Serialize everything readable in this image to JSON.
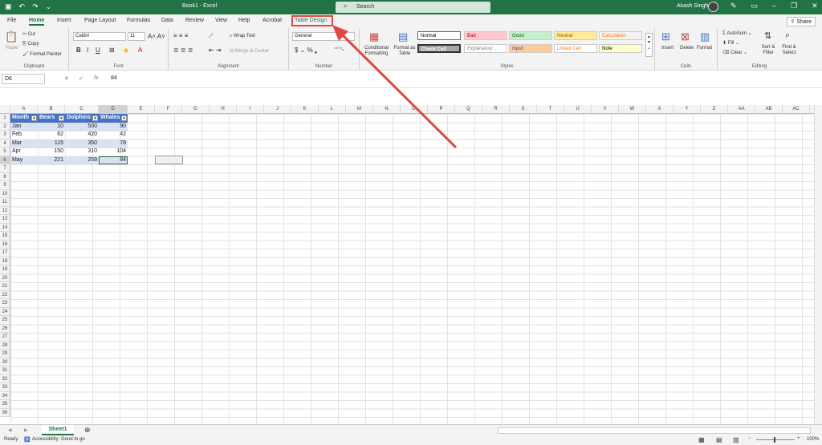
{
  "title_bar": {
    "title": "Book1 - Excel",
    "search_placeholder": "Search",
    "user_name": "Akash Singh"
  },
  "tabs": [
    "File",
    "Home",
    "Insert",
    "Page Layout",
    "Formulas",
    "Data",
    "Review",
    "View",
    "Help",
    "Acrobat",
    "Table Design"
  ],
  "share_label": "Share",
  "ribbon": {
    "clipboard": {
      "label": "Clipboard",
      "paste": "Paste",
      "cut": "Cut",
      "copy": "Copy",
      "format_painter": "Format Painter"
    },
    "font": {
      "label": "Font",
      "name": "Calibri",
      "size": "11"
    },
    "alignment": {
      "label": "Alignment",
      "wrap_text": "Wrap Text",
      "merge_center": "Merge & Center"
    },
    "number": {
      "label": "Number",
      "format": "General"
    },
    "styles": {
      "label": "Styles",
      "conditional_formatting": "Conditional Formatting",
      "format_as_table": "Format as Table",
      "cells": [
        {
          "text": "Normal",
          "bg": "#ffffff",
          "fg": "#000000"
        },
        {
          "text": "Bad",
          "bg": "#ffc7ce",
          "fg": "#9c0006"
        },
        {
          "text": "Good",
          "bg": "#c6efce",
          "fg": "#006100"
        },
        {
          "text": "Neutral",
          "bg": "#ffeb9c",
          "fg": "#9c5700"
        },
        {
          "text": "Calculation",
          "bg": "#f2f2f2",
          "fg": "#fa7d00"
        },
        {
          "text": "Check Cell",
          "bg": "#a5a5a5",
          "fg": "#ffffff"
        },
        {
          "text": "Explanatory ...",
          "bg": "#ffffff",
          "fg": "#7f7f7f"
        },
        {
          "text": "Input",
          "bg": "#ffcc99",
          "fg": "#3f3f76"
        },
        {
          "text": "Linked Cell",
          "bg": "#ffffff",
          "fg": "#fa7d00"
        },
        {
          "text": "Note",
          "bg": "#ffffcc",
          "fg": "#000000"
        }
      ]
    },
    "cells": {
      "label": "Cells",
      "insert": "Insert",
      "delete": "Delete",
      "format": "Format"
    },
    "editing": {
      "label": "Editing",
      "autosum": "AutoSum",
      "fill": "Fill",
      "clear": "Clear",
      "sort_filter": "Sort & Filter",
      "find_select": "Find & Select"
    }
  },
  "formula_bar": {
    "name_box": "D6",
    "value": "84"
  },
  "columns": [
    "A",
    "B",
    "C",
    "D",
    "E",
    "F",
    "G",
    "H",
    "I",
    "J",
    "K",
    "L",
    "M",
    "N",
    "O",
    "P",
    "Q",
    "R",
    "S",
    "T",
    "U",
    "V",
    "W",
    "X",
    "Y",
    "Z",
    "AA",
    "AB",
    "AC"
  ],
  "row_count": 36,
  "table": {
    "headers": [
      "Month",
      "Bears",
      "Dolphins",
      "Whales"
    ],
    "rows": [
      [
        "Jan",
        "10",
        "500",
        "90"
      ],
      [
        "Feb",
        "62",
        "420",
        "42"
      ],
      [
        "Mar",
        "115",
        "350",
        "78"
      ],
      [
        "Apr",
        "150",
        "310",
        "104"
      ],
      [
        "May",
        "221",
        "259",
        "84"
      ]
    ]
  },
  "sheet_tab": "Sheet1",
  "status": {
    "ready": "Ready",
    "accessibility": "Accessibility: Good to go",
    "zoom": "100%"
  },
  "colors": {
    "accent": "#217346",
    "table_header": "#4472c4",
    "band": "#d9e1f2",
    "highlight": "#e04848"
  }
}
